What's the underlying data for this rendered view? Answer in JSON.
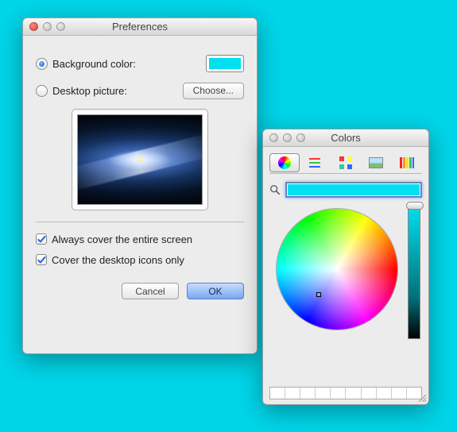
{
  "prefs": {
    "title": "Preferences",
    "background_color_label": "Background color:",
    "background_color_selected": true,
    "background_color_value": "#00e0f0",
    "desktop_picture_label": "Desktop picture:",
    "desktop_picture_selected": false,
    "choose_label": "Choose...",
    "check1_label": "Always cover the entire screen",
    "check1_checked": true,
    "check2_label": "Cover the desktop icons only",
    "check2_checked": true,
    "cancel_label": "Cancel",
    "ok_label": "OK"
  },
  "colors": {
    "title": "Colors",
    "selected_color": "#00e0f0",
    "swatch_count": 10,
    "tabs": [
      "wheel",
      "sliders",
      "palettes",
      "image",
      "crayons"
    ],
    "selected_tab": "wheel"
  }
}
